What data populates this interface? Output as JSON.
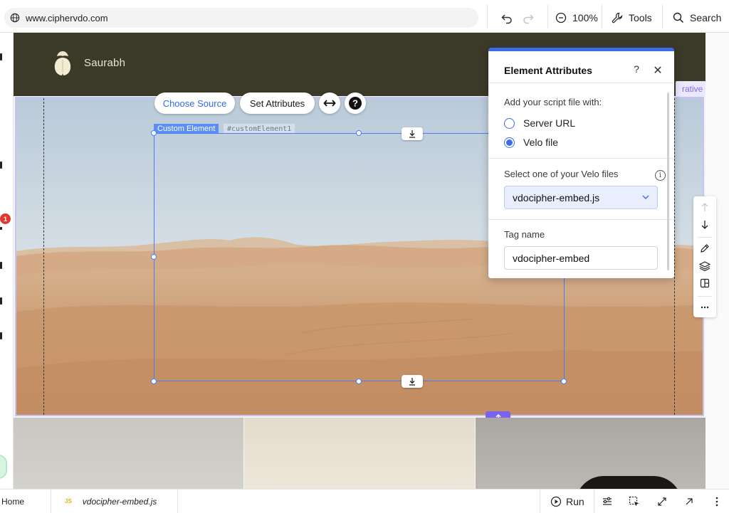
{
  "browser": {
    "url": "www.ciphervdo.com",
    "zoom": "100%",
    "tools_label": "Tools",
    "search_label": "Search"
  },
  "site": {
    "brand": "Saurabh",
    "strip_tag": "rative"
  },
  "sidebar": {
    "notification_count": "1"
  },
  "element_toolbar": {
    "choose_source": "Choose Source",
    "set_attributes": "Set Attributes"
  },
  "selection": {
    "type_label": "Custom Element",
    "id_label": "#customElement1"
  },
  "panel": {
    "title": "Element Attributes",
    "help": "?",
    "close": "✕",
    "script_prompt": "Add your script file with:",
    "options": [
      {
        "label": "Server URL",
        "checked": false
      },
      {
        "label": "Velo file",
        "checked": true
      }
    ],
    "velo_prompt": "Select one of your Velo files",
    "selected_file": "vdocipher-embed.js",
    "tag_label": "Tag name",
    "tag_value": "vdocipher-embed"
  },
  "bottom": {
    "home": "Home",
    "file": "vdocipher-embed.js",
    "file_badge": "JS",
    "run": "Run"
  },
  "colors": {
    "accent": "#3b6be9",
    "selection": "#4a7cf5",
    "stretch": "#7b63f2",
    "header": "#3b3a28"
  }
}
